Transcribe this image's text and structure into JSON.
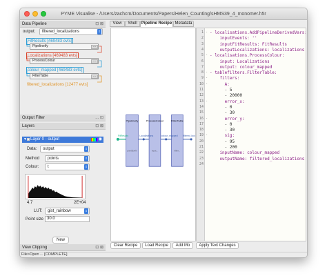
{
  "window": {
    "title": "PYME Visualise - /Users/zachcm/Documents/Papers/Helen_Counting/sHMS39_4_monomer.h5r",
    "status": "File>Open ... [COMPLETE]"
  },
  "data_pipeline": {
    "title": "Data Pipeline",
    "output_label": "output:",
    "output_value": "filtered_localizations",
    "datasources": [
      {
        "label": "FitResults [469483 evts]",
        "color": "#2f9fd6"
      },
      {
        "label": "Localizations [469483 evts]",
        "color": "#d9462f"
      },
      {
        "label": "colour_mapped [469483 evts]",
        "color": "#2f9fd6"
      },
      {
        "label": "filtered_localizations [12477 evts]",
        "color": "#e0952a"
      }
    ],
    "modules": [
      "Pipelineify",
      "ProcessColour",
      "FilterTable"
    ],
    "dots": "...",
    "dock_controls": "⊡ ⊠"
  },
  "output_filter": {
    "title": "Output Filter",
    "dock_controls": "... ⊡"
  },
  "layers": {
    "title": "Layers",
    "dock_controls": "⊡ ⊠",
    "layer_name": "Layer 0 - output",
    "data_label": "Data:",
    "data_value": "output",
    "method_label": "Method",
    "method_value": "points",
    "colour_label": "Colour:",
    "colour_value": "t",
    "hist_min": "4.7",
    "hist_max": "2E+04",
    "lut_label": "LUT:",
    "lut_value": "gist_rainbow",
    "point_size_label": "Point size",
    "point_size_value": "30.0",
    "new_button": "New"
  },
  "view_clipping": {
    "title": "View Clipping",
    "dock_controls": "⊡ ⊠"
  },
  "tabs": [
    {
      "label": "View",
      "active": false
    },
    {
      "label": "Shell",
      "active": false
    },
    {
      "label": "Pipeline Recipe",
      "active": true
    },
    {
      "label": "Metadata",
      "active": false
    }
  ],
  "graph": {
    "modules": [
      "Pipelineify",
      "ProcessColour",
      "FilterTable"
    ],
    "links": [
      "FitResults",
      "Localizations",
      "colour_mapped",
      "filtered_localizations"
    ],
    "params": [
      "pixelSizeN",
      "input...",
      "fillter..."
    ]
  },
  "recipe_lines": [
    {
      "n": "1",
      "fold": "-",
      "text": "- localisations.AddPipelineDerivedVars:",
      "kind": "k"
    },
    {
      "n": "2",
      "fold": "",
      "text": "    inputEvents: ''",
      "kind": "k"
    },
    {
      "n": "3",
      "fold": "",
      "text": "    inputFitResults: FitResults",
      "kind": "k"
    },
    {
      "n": "4",
      "fold": "",
      "text": "    outputLocalizations: localizations",
      "kind": "k"
    },
    {
      "n": "5",
      "fold": "-",
      "text": "- localisations.ProcessColour:",
      "kind": "k"
    },
    {
      "n": "6",
      "fold": "",
      "text": "    input: Localizations",
      "kind": "k"
    },
    {
      "n": "7",
      "fold": "",
      "text": "    output: colour_mapped",
      "kind": "k"
    },
    {
      "n": "8",
      "fold": "-",
      "text": "- tablefilters.FilterTable:",
      "kind": "k"
    },
    {
      "n": "9",
      "fold": "-",
      "text": "    filters:",
      "kind": "k"
    },
    {
      "n": "10",
      "fold": "-",
      "text": "      A:",
      "kind": "k"
    },
    {
      "n": "11",
      "fold": "",
      "text": "      - 5",
      "kind": "v"
    },
    {
      "n": "12",
      "fold": "",
      "text": "      - 20000",
      "kind": "v"
    },
    {
      "n": "13",
      "fold": "-",
      "text": "      error_x:",
      "kind": "k"
    },
    {
      "n": "14",
      "fold": "",
      "text": "      - 0",
      "kind": "v"
    },
    {
      "n": "15",
      "fold": "",
      "text": "      - 30",
      "kind": "v"
    },
    {
      "n": "16",
      "fold": "-",
      "text": "      error_y:",
      "kind": "k"
    },
    {
      "n": "17",
      "fold": "",
      "text": "      - 0",
      "kind": "v"
    },
    {
      "n": "18",
      "fold": "",
      "text": "      - 30",
      "kind": "v"
    },
    {
      "n": "19",
      "fold": "-",
      "text": "      sig:",
      "kind": "k"
    },
    {
      "n": "20",
      "fold": "",
      "text": "      - 95",
      "kind": "v"
    },
    {
      "n": "21",
      "fold": "",
      "text": "      - 200",
      "kind": "v"
    },
    {
      "n": "22",
      "fold": "",
      "text": "    inputName: colour_mapped",
      "kind": "k"
    },
    {
      "n": "23",
      "fold": "",
      "text": "    outputName: filtered_localizations",
      "kind": "k"
    },
    {
      "n": "24",
      "fold": "",
      "text": "",
      "kind": "k"
    }
  ],
  "bottom_buttons": [
    "Clear Recipe",
    "Load Recipe",
    "Add Mo",
    "Apply Text Changes"
  ]
}
